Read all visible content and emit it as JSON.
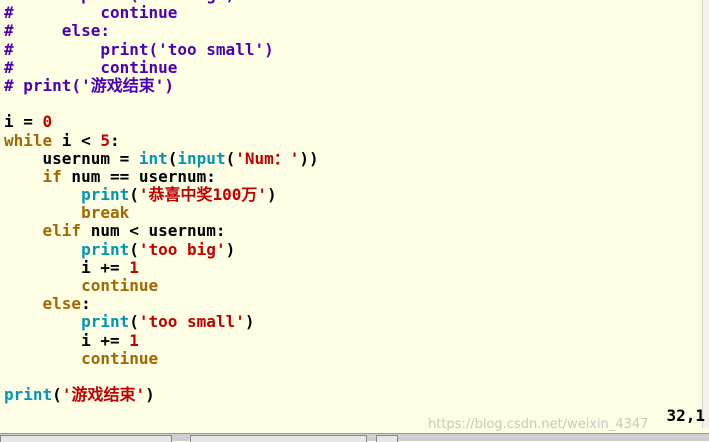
{
  "code_lines": [
    {
      "indent": "#       ",
      "tokens": [
        {
          "text": "print('too big')",
          "cls": "t-comment"
        }
      ]
    },
    {
      "indent": "",
      "tokens": [
        {
          "text": "#         continue",
          "cls": "t-comment"
        }
      ]
    },
    {
      "indent": "",
      "tokens": [
        {
          "text": "#     else:",
          "cls": "t-comment"
        }
      ]
    },
    {
      "indent": "",
      "tokens": [
        {
          "text": "#         print('too small')",
          "cls": "t-comment"
        }
      ]
    },
    {
      "indent": "",
      "tokens": [
        {
          "text": "#         continue",
          "cls": "t-comment"
        }
      ]
    },
    {
      "indent": "",
      "tokens": [
        {
          "text": "# print('游戏结束')",
          "cls": "t-comment"
        }
      ]
    },
    {
      "indent": "",
      "tokens": []
    },
    {
      "indent": "",
      "tokens": [
        {
          "text": "i = ",
          "cls": "t-plain"
        },
        {
          "text": "0",
          "cls": "t-number"
        }
      ]
    },
    {
      "indent": "",
      "tokens": [
        {
          "text": "while",
          "cls": "t-keyword"
        },
        {
          "text": " i < ",
          "cls": "t-plain"
        },
        {
          "text": "5",
          "cls": "t-number"
        },
        {
          "text": ":",
          "cls": "t-plain"
        }
      ]
    },
    {
      "indent": "    ",
      "tokens": [
        {
          "text": "usernum = ",
          "cls": "t-plain"
        },
        {
          "text": "int",
          "cls": "t-builtin"
        },
        {
          "text": "(",
          "cls": "t-plain"
        },
        {
          "text": "input",
          "cls": "t-builtin"
        },
        {
          "text": "(",
          "cls": "t-plain"
        },
        {
          "text": "'Num：'",
          "cls": "t-string"
        },
        {
          "text": "))",
          "cls": "t-plain"
        }
      ]
    },
    {
      "indent": "    ",
      "tokens": [
        {
          "text": "if",
          "cls": "t-keyword"
        },
        {
          "text": " num == usernum:",
          "cls": "t-plain"
        }
      ]
    },
    {
      "indent": "        ",
      "tokens": [
        {
          "text": "print",
          "cls": "t-builtin"
        },
        {
          "text": "(",
          "cls": "t-plain"
        },
        {
          "text": "'恭喜中奖100万'",
          "cls": "t-string"
        },
        {
          "text": ")",
          "cls": "t-plain"
        }
      ]
    },
    {
      "indent": "        ",
      "tokens": [
        {
          "text": "break",
          "cls": "t-keyword"
        }
      ]
    },
    {
      "indent": "    ",
      "tokens": [
        {
          "text": "elif",
          "cls": "t-keyword"
        },
        {
          "text": " num < usernum:",
          "cls": "t-plain"
        }
      ]
    },
    {
      "indent": "        ",
      "tokens": [
        {
          "text": "print",
          "cls": "t-builtin"
        },
        {
          "text": "(",
          "cls": "t-plain"
        },
        {
          "text": "'too big'",
          "cls": "t-string"
        },
        {
          "text": ")",
          "cls": "t-plain"
        }
      ]
    },
    {
      "indent": "        ",
      "tokens": [
        {
          "text": "i += ",
          "cls": "t-plain"
        },
        {
          "text": "1",
          "cls": "t-number"
        }
      ]
    },
    {
      "indent": "        ",
      "tokens": [
        {
          "text": "continue",
          "cls": "t-keyword"
        }
      ]
    },
    {
      "indent": "    ",
      "tokens": [
        {
          "text": "else",
          "cls": "t-keyword"
        },
        {
          "text": ":",
          "cls": "t-plain"
        }
      ]
    },
    {
      "indent": "        ",
      "tokens": [
        {
          "text": "print",
          "cls": "t-builtin"
        },
        {
          "text": "(",
          "cls": "t-plain"
        },
        {
          "text": "'too small'",
          "cls": "t-string"
        },
        {
          "text": ")",
          "cls": "t-plain"
        }
      ]
    },
    {
      "indent": "        ",
      "tokens": [
        {
          "text": "i += ",
          "cls": "t-plain"
        },
        {
          "text": "1",
          "cls": "t-number"
        }
      ]
    },
    {
      "indent": "        ",
      "tokens": [
        {
          "text": "continue",
          "cls": "t-keyword"
        }
      ]
    },
    {
      "indent": "",
      "tokens": []
    },
    {
      "indent": "",
      "tokens": [
        {
          "text": "print",
          "cls": "t-builtin"
        },
        {
          "text": "(",
          "cls": "t-plain"
        },
        {
          "text": "'游戏结束'",
          "cls": "t-string"
        },
        {
          "text": ")",
          "cls": "t-plain"
        }
      ]
    }
  ],
  "status": {
    "cursor_position": "32,1"
  },
  "watermark": "https://blog.csdn.net/weixin_4347",
  "colors": {
    "background": "#fefee4",
    "comment": "#4a00b4",
    "keyword": "#a16800",
    "builtin": "#0096b4",
    "string": "#c00000",
    "number": "#c00000"
  }
}
